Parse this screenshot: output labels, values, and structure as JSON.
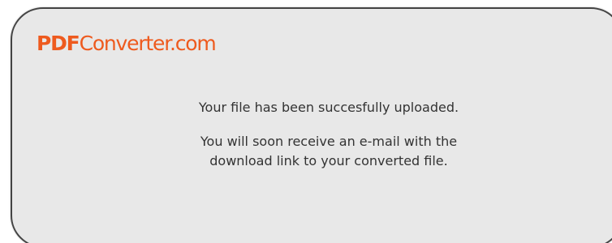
{
  "logo": {
    "strong": "PDF",
    "rest": "Converter.com"
  },
  "messages": {
    "upload_success": "Your file has been succesfully uploaded.",
    "email_line_1": "You will soon receive an e-mail with the",
    "email_line_2": "download link to your converted file."
  },
  "colors": {
    "brand": "#ee5a1e",
    "panel_background": "#e8e8e8",
    "panel_border": "#444444",
    "text": "#333333"
  }
}
